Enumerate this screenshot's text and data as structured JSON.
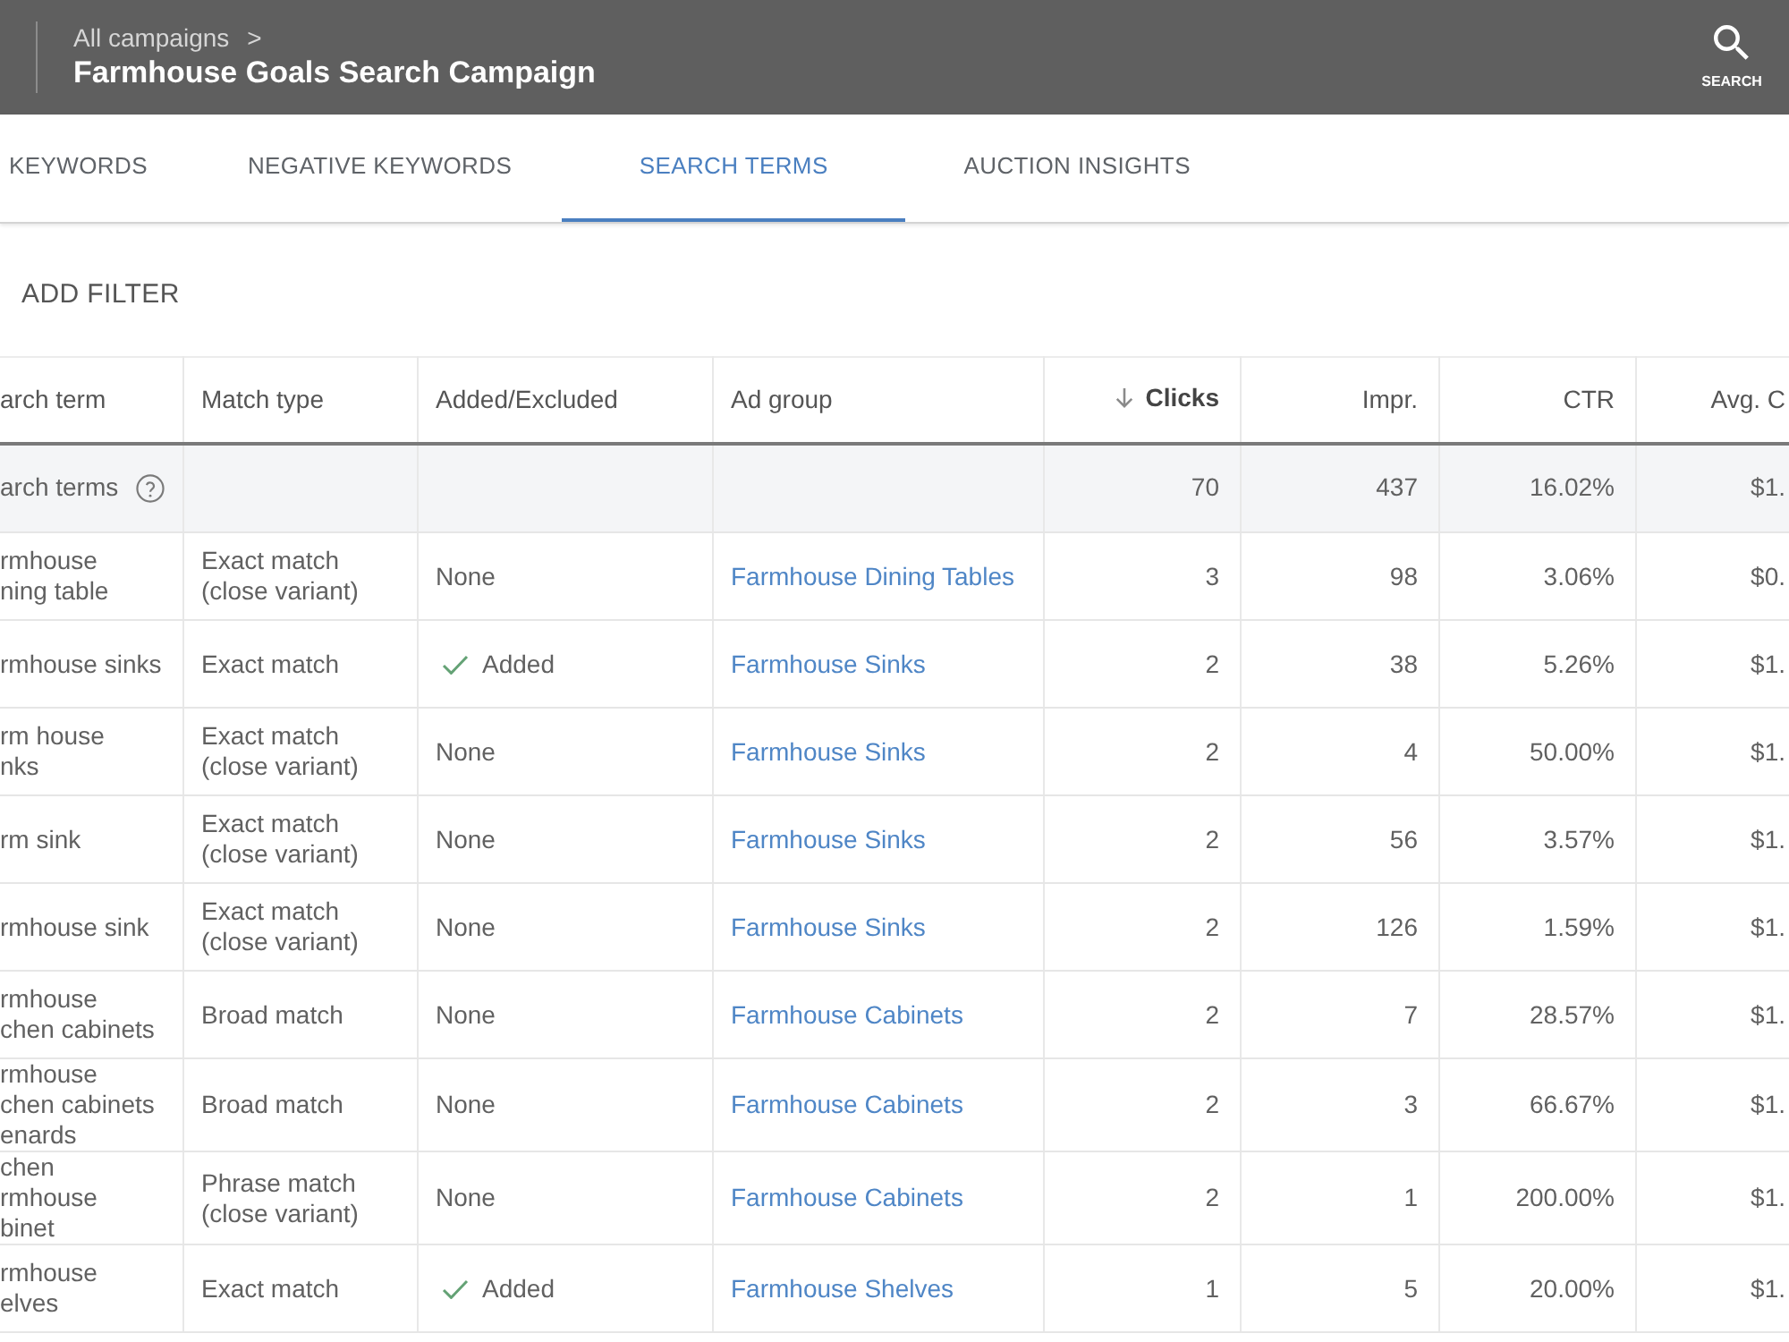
{
  "header": {
    "breadcrumb": "All campaigns",
    "breadcrumb_separator": ">",
    "title": "Farmhouse Goals Search Campaign",
    "search_label": "SEARCH"
  },
  "tabs": [
    {
      "label": "KEYWORDS",
      "selected": false
    },
    {
      "label": "NEGATIVE KEYWORDS",
      "selected": false
    },
    {
      "label": "SEARCH TERMS",
      "selected": true
    },
    {
      "label": "AUCTION INSIGHTS",
      "selected": false
    }
  ],
  "filter_button": "ADD FILTER",
  "table": {
    "columns": [
      {
        "label": "arch term",
        "kind": "term",
        "sorted": false
      },
      {
        "label": "Match type",
        "kind": "match",
        "sorted": false
      },
      {
        "label": "Added/Excluded",
        "kind": "status",
        "sorted": false
      },
      {
        "label": "Ad group",
        "kind": "link",
        "sorted": false
      },
      {
        "label": "Clicks",
        "kind": "number",
        "sorted": true
      },
      {
        "label": "Impr.",
        "kind": "number",
        "sorted": false
      },
      {
        "label": "CTR",
        "kind": "number",
        "sorted": false
      },
      {
        "label": "Avg. C",
        "kind": "number",
        "sorted": false
      }
    ],
    "total_row": {
      "label": "arch terms",
      "values": [
        "70",
        "437",
        "16.02%",
        "$1."
      ]
    },
    "rows": [
      {
        "cells": [
          "rmhouse\nning table",
          "Exact match (close variant)",
          "None",
          "Farmhouse Dining Tables",
          "3",
          "98",
          "3.06%",
          "$0."
        ],
        "added": false
      },
      {
        "cells": [
          "rmhouse sinks",
          "Exact match",
          "Added",
          "Farmhouse Sinks",
          "2",
          "38",
          "5.26%",
          "$1."
        ],
        "added": true
      },
      {
        "cells": [
          "rm house\nnks",
          "Exact match (close variant)",
          "None",
          "Farmhouse Sinks",
          "2",
          "4",
          "50.00%",
          "$1."
        ],
        "added": false
      },
      {
        "cells": [
          "rm sink",
          "Exact match (close variant)",
          "None",
          "Farmhouse Sinks",
          "2",
          "56",
          "3.57%",
          "$1."
        ],
        "added": false
      },
      {
        "cells": [
          "rmhouse sink",
          "Exact match (close variant)",
          "None",
          "Farmhouse Sinks",
          "2",
          "126",
          "1.59%",
          "$1."
        ],
        "added": false
      },
      {
        "cells": [
          "rmhouse\nchen cabinets",
          "Broad match",
          "None",
          "Farmhouse Cabinets",
          "2",
          "7",
          "28.57%",
          "$1."
        ],
        "added": false
      },
      {
        "cells": [
          "rmhouse\nchen cabinets\nenards",
          "Broad match",
          "None",
          "Farmhouse Cabinets",
          "2",
          "3",
          "66.67%",
          "$1."
        ],
        "added": false
      },
      {
        "cells": [
          "chen\nrmhouse\nbinet",
          "Phrase match (close variant)",
          "None",
          "Farmhouse Cabinets",
          "2",
          "1",
          "200.00%",
          "$1."
        ],
        "added": false
      },
      {
        "cells": [
          "rmhouse\nelves",
          "Exact match",
          "Added",
          "Farmhouse Shelves",
          "1",
          "5",
          "20.00%",
          "$1."
        ],
        "added": true
      }
    ]
  }
}
